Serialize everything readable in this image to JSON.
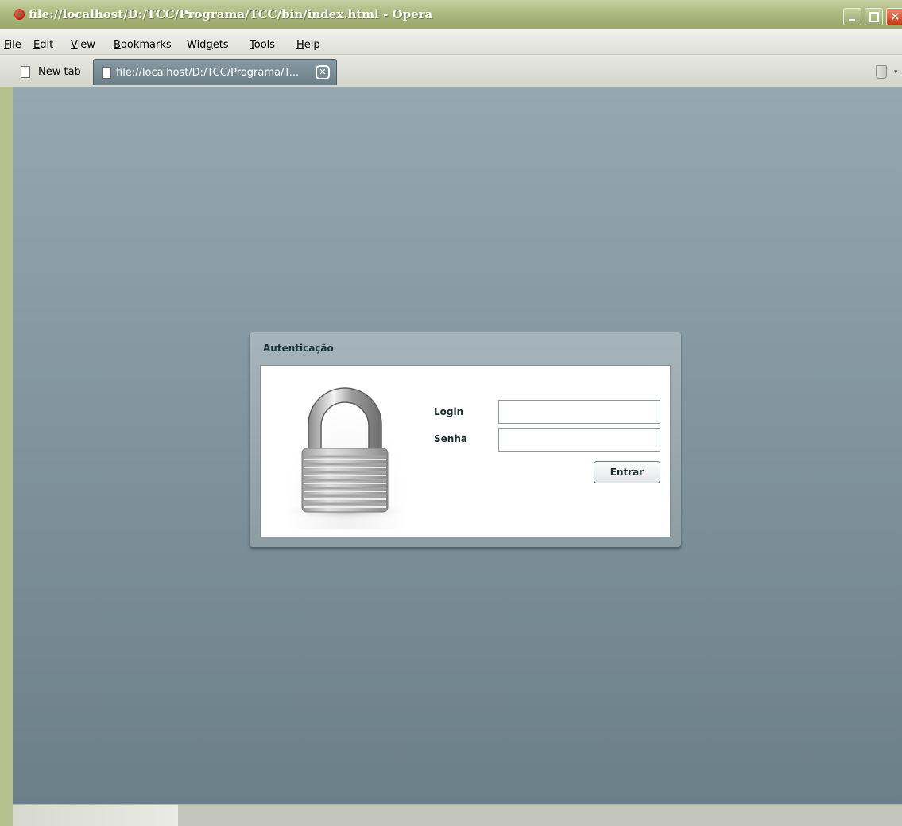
{
  "window": {
    "title": "file://localhost/D:/TCC/Programa/TCC/bin/index.html - Opera",
    "app_icon": "opera-icon",
    "controls": [
      "minimize-icon",
      "maximize-icon",
      "close-icon"
    ]
  },
  "menu": {
    "items": [
      {
        "accel": "F",
        "rest": "ile"
      },
      {
        "accel": "E",
        "rest": "dit"
      },
      {
        "accel": "V",
        "rest": "iew"
      },
      {
        "accel": "B",
        "rest": "ookmarks"
      },
      {
        "pre": "Wid",
        "accel": "g",
        "rest": "ets"
      },
      {
        "accel": "T",
        "rest": "ools"
      },
      {
        "accel": "H",
        "rest": "elp"
      }
    ]
  },
  "tabs": {
    "new_tab_label": "New tab",
    "active_tab_label": "file://localhost/D:/TCC/Programa/T...",
    "close_icon": "close-icon",
    "trash_icon": "trash-icon"
  },
  "auth": {
    "title": "Autenticação",
    "lock_icon": "lock-icon",
    "login_label": "Login",
    "login_value": "",
    "senha_label": "Senha",
    "senha_value": "",
    "submit_label": "Entrar"
  },
  "colors": {
    "titlebar": "#a9b57b",
    "content_top": "#95a8b1",
    "content_bottom": "#6b7f89",
    "panel": "#9fb0b7"
  }
}
